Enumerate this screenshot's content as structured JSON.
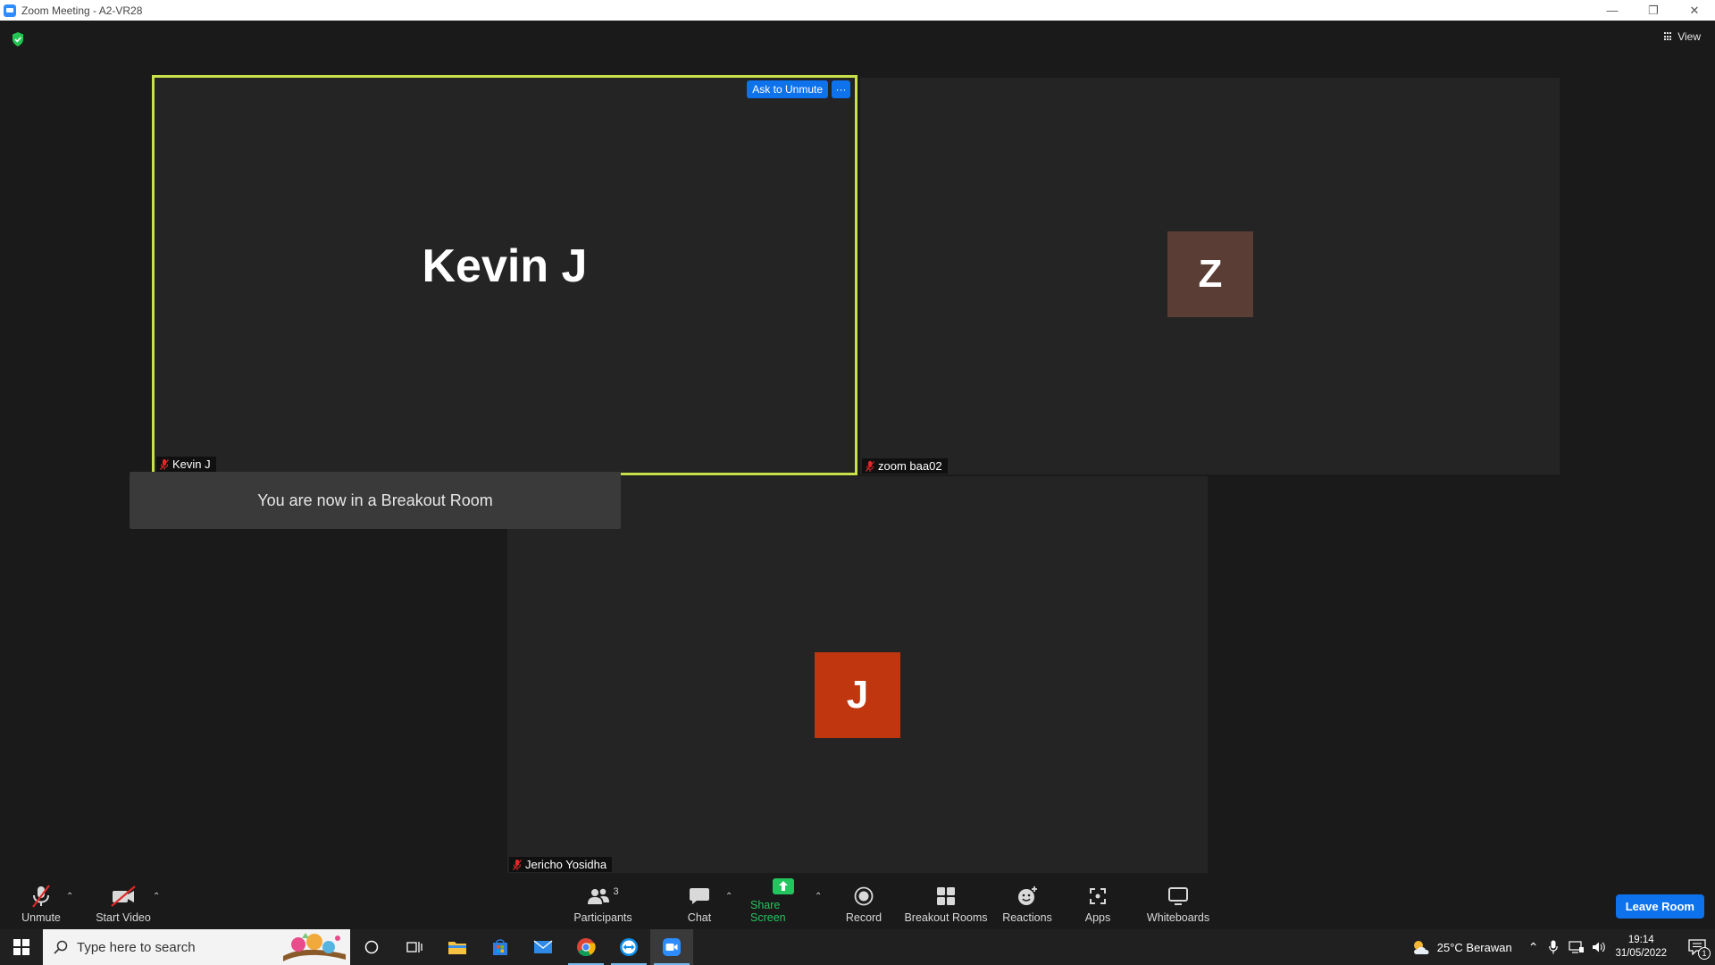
{
  "window": {
    "title": "Zoom Meeting - A2-VR28",
    "minimize": "—",
    "restore": "❐",
    "close": "✕"
  },
  "header": {
    "view_label": "View"
  },
  "tiles": {
    "kevin": {
      "display_name": "Kevin J",
      "name_tag": "Kevin J",
      "ask_unmute": "Ask to Unmute",
      "more": "···",
      "highlight_color": "#c8e04a"
    },
    "zoom": {
      "avatar_letter": "Z",
      "name_tag": "zoom baa02",
      "avatar_color": "#5a3d35"
    },
    "jericho": {
      "avatar_letter": "J",
      "name_tag": "Jericho Yosidha",
      "avatar_color": "#c0360f"
    }
  },
  "toast": {
    "message": "You are now in a Breakout Room"
  },
  "toolbar": {
    "unmute": "Unmute",
    "start_video": "Start Video",
    "participants": "Participants",
    "participants_count": "3",
    "chat": "Chat",
    "share_screen": "Share Screen",
    "record": "Record",
    "breakout_rooms": "Breakout Rooms",
    "reactions": "Reactions",
    "apps": "Apps",
    "whiteboards": "Whiteboards",
    "leave_room": "Leave Room"
  },
  "taskbar": {
    "search_placeholder": "Type here to search",
    "weather": "25°C  Berawan",
    "time": "19:14",
    "date": "31/05/2022",
    "notification_count": "1"
  }
}
